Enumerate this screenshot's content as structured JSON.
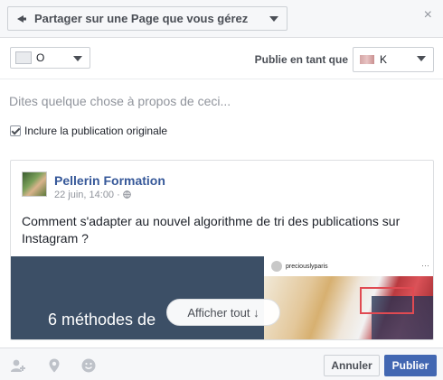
{
  "header": {
    "share_label": "Partager sur une Page que vous gérez",
    "close_symbol": "×"
  },
  "selector_row": {
    "target_value": "O",
    "publish_as_label": "Publie en tant que",
    "page_value": "K"
  },
  "composer": {
    "placeholder": "Dites quelque chose à propos de ceci..."
  },
  "include_original": {
    "label": "Inclure la publication originale",
    "checked": true
  },
  "post": {
    "page_name": "Pellerin Formation",
    "meta": "22 juin, 14:00 · ",
    "text": "Comment s'adapter au nouvel algorithme de tri des publications sur Instagram ?",
    "image_slogan": "6 méthodes de",
    "instagram_account": "preciouslyparis",
    "instagram_menu": "···",
    "show_all_label": "Afficher tout ↓"
  },
  "footer": {
    "cancel_label": "Annuler",
    "publish_label": "Publier"
  },
  "colors": {
    "brand_blue": "#4267b2",
    "link_blue": "#365899",
    "header_bg": "#f6f7f9"
  },
  "icons": [
    "share-icon",
    "close-icon",
    "chevron-down-icon",
    "globe-icon",
    "tag-people-icon",
    "location-pin-icon",
    "emoji-icon"
  ]
}
